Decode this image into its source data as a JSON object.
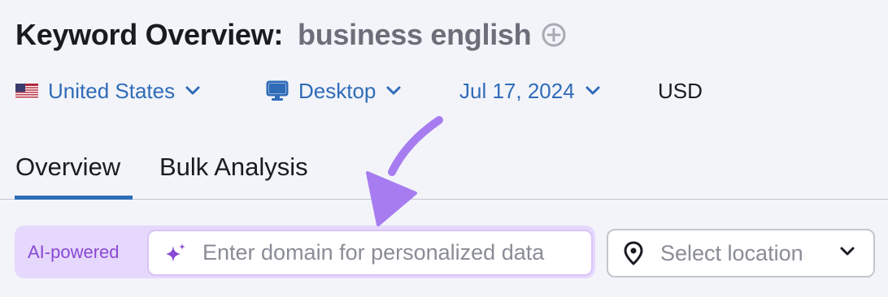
{
  "header": {
    "title": "Keyword Overview:",
    "keyword": "business english",
    "add_icon": "plus-circle-icon"
  },
  "filters": {
    "country": "United States",
    "country_flag": "us-flag-icon",
    "device": "Desktop",
    "device_icon": "desktop-monitor-icon",
    "date": "Jul 17, 2024",
    "currency": "USD"
  },
  "tabs": [
    {
      "label": "Overview",
      "active": true
    },
    {
      "label": "Bulk Analysis",
      "active": false
    }
  ],
  "ai_search": {
    "badge": "AI-powered",
    "placeholder": "Enter domain for personalized data",
    "value": "",
    "icon": "sparkle-icon"
  },
  "location": {
    "placeholder": "Select location",
    "icon": "map-pin-icon"
  },
  "annotation": {
    "arrow_color": "#a77cf0"
  },
  "colors": {
    "accent": "#2f6cb8",
    "ai_purple": "#8a49d4",
    "ai_background": "#e6d8fc",
    "page_background": "#f3f4f9"
  }
}
